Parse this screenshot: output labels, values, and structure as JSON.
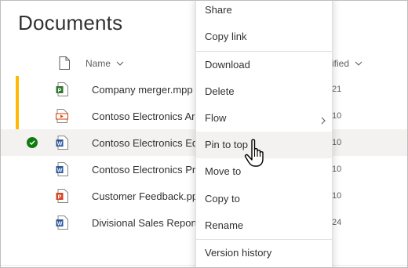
{
  "page": {
    "title": "Documents"
  },
  "columns": {
    "name": "Name",
    "modified": "ified"
  },
  "files": [
    {
      "name": "Company merger.mpp",
      "modified": "21",
      "type": "project",
      "pinned": true,
      "selected": false
    },
    {
      "name": "Contoso Electronics Ar",
      "modified": "10",
      "type": "video",
      "pinned": true,
      "selected": false
    },
    {
      "name": "Contoso Electronics Ed",
      "modified": "10",
      "type": "word",
      "pinned": false,
      "selected": true
    },
    {
      "name": "Contoso Electronics Pr",
      "modified": "10",
      "type": "word",
      "pinned": false,
      "selected": false
    },
    {
      "name": "Customer Feedback.pp",
      "modified": "10",
      "type": "powerpoint",
      "pinned": false,
      "selected": false
    },
    {
      "name": "Divisional Sales Report",
      "modified": "24",
      "type": "word",
      "pinned": false,
      "selected": false
    }
  ],
  "context_menu": {
    "items": [
      {
        "label": "Share"
      },
      {
        "label": "Copy link"
      },
      {
        "label": "Download"
      },
      {
        "label": "Delete"
      },
      {
        "label": "Flow"
      },
      {
        "label": "Pin to top"
      },
      {
        "label": "Move to"
      },
      {
        "label": "Copy to"
      },
      {
        "label": "Rename"
      },
      {
        "label": "Version history"
      }
    ]
  },
  "colors": {
    "pin_accent": "#ffb900",
    "selected_check": "#107c10",
    "word_blue": "#2b579a",
    "project_green": "#31752f",
    "powerpoint_red": "#d24726",
    "video_red": "#d83b01"
  }
}
